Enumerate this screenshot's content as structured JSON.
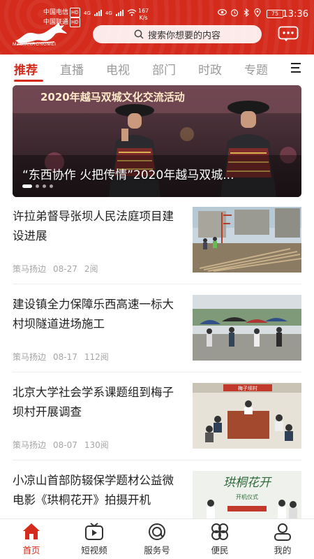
{
  "status_bar": {
    "carrier1": "中国电信",
    "carrier2": "中国联通",
    "hd": "HD",
    "net1": "4G",
    "net2": "4G",
    "speed_value": "167",
    "speed_unit": "K/s",
    "battery": "75",
    "time": "13:36"
  },
  "header": {
    "logo_text": "MABIANRONGMEI",
    "search_placeholder": "搜索你想要的内容"
  },
  "tabs": [
    {
      "label": "推荐",
      "active": true
    },
    {
      "label": "直播",
      "active": false
    },
    {
      "label": "电视",
      "active": false
    },
    {
      "label": "部门",
      "active": false
    },
    {
      "label": "时政",
      "active": false
    },
    {
      "label": "专题",
      "active": false
    }
  ],
  "banner": {
    "caption": "“东西协作 火把传情”2020年越马双城...",
    "backdrop_text": "2020年越马双城文化交流活动",
    "slide_count": 4,
    "active_slide": 1
  },
  "news": [
    {
      "title": "许拉弟督导张坝人民法庭项目建设进展",
      "source": "策马扬边",
      "date": "08-27",
      "reads": "2阅"
    },
    {
      "title": "建设镇全力保障乐西高速一标大村坝隧道进场施工",
      "source": "策马扬边",
      "date": "08-17",
      "reads": "112阅"
    },
    {
      "title": "北京大学社会学系课题组到梅子坝村开展调查",
      "source": "策马扬边",
      "date": "08-07",
      "reads": "130阅"
    },
    {
      "title": "小凉山首部防辍保学题材公益微电影《珙桐花开》拍摄开机",
      "source": "",
      "date": "",
      "reads": ""
    }
  ],
  "thumb_text": {
    "poster": "梅子坝村",
    "calligraphy": "珙桐花开",
    "ceremony": "开机仪式"
  },
  "bottom_nav": [
    {
      "label": "首页",
      "icon": "home-icon",
      "active": true
    },
    {
      "label": "短视频",
      "icon": "video-icon",
      "active": false
    },
    {
      "label": "服务号",
      "icon": "service-icon",
      "active": false
    },
    {
      "label": "便民",
      "icon": "convenience-icon",
      "active": false
    },
    {
      "label": "我的",
      "icon": "profile-icon",
      "active": false
    }
  ],
  "colors": {
    "brand_red": "#d42b1c",
    "inactive_text": "#9a9a9a",
    "meta_text": "#a6a6a6"
  }
}
